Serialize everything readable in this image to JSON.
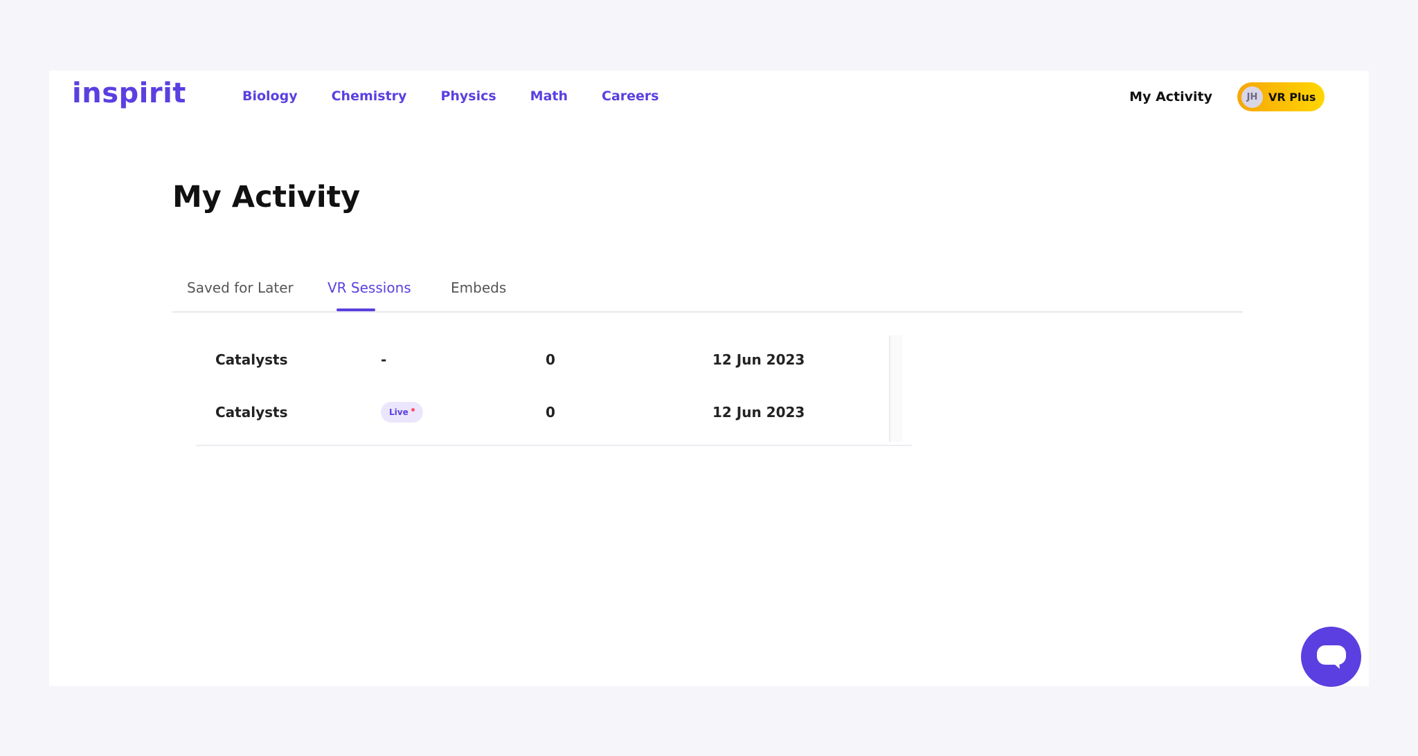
{
  "brand": {
    "logo_text": "inspirit",
    "accent_color": "#5b3fe0"
  },
  "nav": {
    "items": [
      {
        "label": "Biology"
      },
      {
        "label": "Chemistry"
      },
      {
        "label": "Physics"
      },
      {
        "label": "Math"
      },
      {
        "label": "Careers"
      }
    ]
  },
  "header": {
    "my_activity_label": "My Activity",
    "avatar_initials": "JH",
    "plan_label": "VR Plus"
  },
  "page": {
    "title": "My Activity"
  },
  "tabs": [
    {
      "label": "Saved for Later",
      "active": false
    },
    {
      "label": "VR Sessions",
      "active": true
    },
    {
      "label": "Embeds",
      "active": false
    }
  ],
  "sessions": [
    {
      "title": "Catalysts",
      "status": "-",
      "count": "0",
      "date": "12 Jun 2023"
    },
    {
      "title": "Catalysts",
      "status": "Live",
      "count": "0",
      "date": "12 Jun 2023"
    }
  ],
  "chat": {
    "icon": "chat-bubble-icon"
  }
}
